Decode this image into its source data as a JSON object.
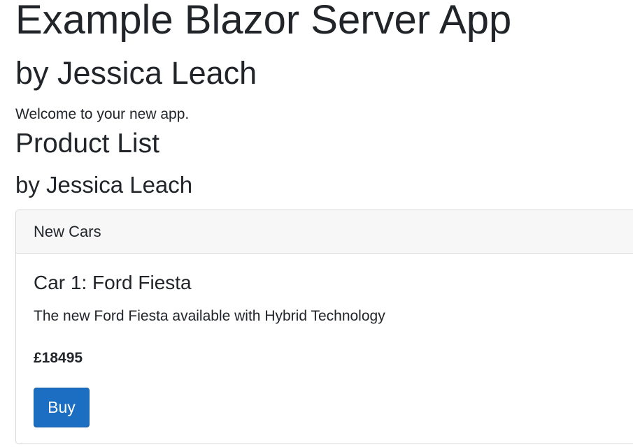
{
  "header": {
    "title": "Example Blazor Server App",
    "author": "by Jessica Leach",
    "welcome": "Welcome to your new app."
  },
  "product_list": {
    "title": "Product List",
    "author": "by Jessica Leach",
    "card": {
      "header": "New Cars",
      "title": "Car 1: Ford Fiesta",
      "description": "The new Ford Fiesta available with Hybrid Technology",
      "price": "£18495",
      "buy_label": "Buy"
    }
  },
  "colors": {
    "button_background": "#1b6ec2",
    "card_header_background": "#f7f7f7"
  }
}
